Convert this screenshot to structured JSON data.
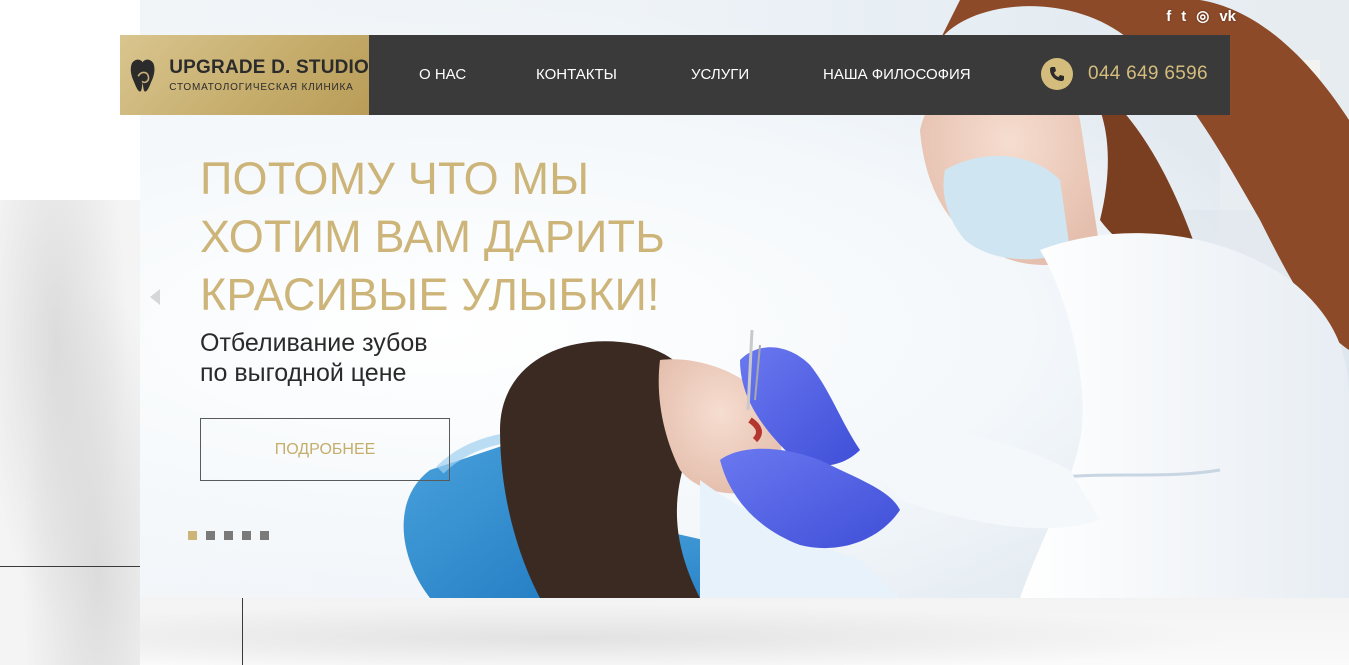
{
  "social": {
    "facebook": "f",
    "twitter": "t",
    "instagram": "◎",
    "vk": "vk"
  },
  "logo": {
    "title": "UPGRADE D. STUDIO",
    "subtitle": "СТОМАТОЛОГИЧЕСКАЯ КЛИНИКА"
  },
  "nav": {
    "items": [
      {
        "label": "О НАС"
      },
      {
        "label": "КОНТАКТЫ"
      },
      {
        "label": "УСЛУГИ"
      },
      {
        "label": "НАША ФИЛОСОФИЯ"
      }
    ],
    "phone": "044 649 6596"
  },
  "hero": {
    "headline": [
      "ПОТОМУ ЧТО МЫ",
      "ХОТИМ ВАМ ДАРИТЬ",
      "КРАСИВЫЕ УЛЫБКИ!"
    ],
    "subline": [
      "Отбеливание зубов",
      "по выгодной цене"
    ],
    "button_label": "ПОДРОБНЕЕ",
    "slides_total": 5,
    "active_slide": 1
  },
  "colors": {
    "gold": "#cdb57a",
    "nav_dark": "#3a3a3a",
    "text_dark": "#2a2a2a"
  }
}
